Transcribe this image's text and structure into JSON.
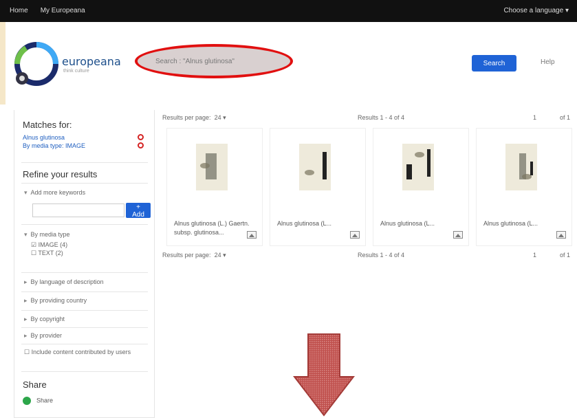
{
  "topbar": {
    "home": "Home",
    "my_europeana": "My Europeana",
    "language": "Choose a language"
  },
  "logo": {
    "name": "europeana",
    "sub": "think culture"
  },
  "search": {
    "value": "Search : \"Alnus glutinosa\""
  },
  "buttons": {
    "search": "Search",
    "help": "Help",
    "add": "+ Add"
  },
  "sidebar": {
    "matches_title": "Matches for:",
    "matches": [
      "Alnus glutinosa",
      "By media type: IMAGE"
    ],
    "refine_title": "Refine your results",
    "add_keywords": "Add more keywords",
    "media_type_label": "By media type",
    "media_options": [
      "IMAGE (4)",
      "TEXT (2)"
    ],
    "facets": [
      "By language of description",
      "By providing country",
      "By copyright",
      "By provider"
    ],
    "include_label": "Include content contributed by users",
    "share_title": "Share",
    "share_label": "Share"
  },
  "results": {
    "per_page_label": "Results per page:",
    "per_page_value": "24",
    "count_text": "Results 1 - 4 of 4",
    "page_number": "1",
    "page_of": "of 1",
    "items": [
      {
        "caption": "Alnus glutinosa (L.) Gaertn. subsp. glutinosa..."
      },
      {
        "caption": "Alnus glutinosa (L..."
      },
      {
        "caption": "Alnus glutinosa (L..."
      },
      {
        "caption": "Alnus glutinosa (L..."
      }
    ]
  },
  "colors": {
    "accent": "#1f63d6",
    "highlight": "#e11010",
    "arrow": "#c0504d"
  },
  "icons": [
    "remove-circle-icon",
    "share-icon",
    "image-type-icon",
    "down-arrow-icon"
  ]
}
